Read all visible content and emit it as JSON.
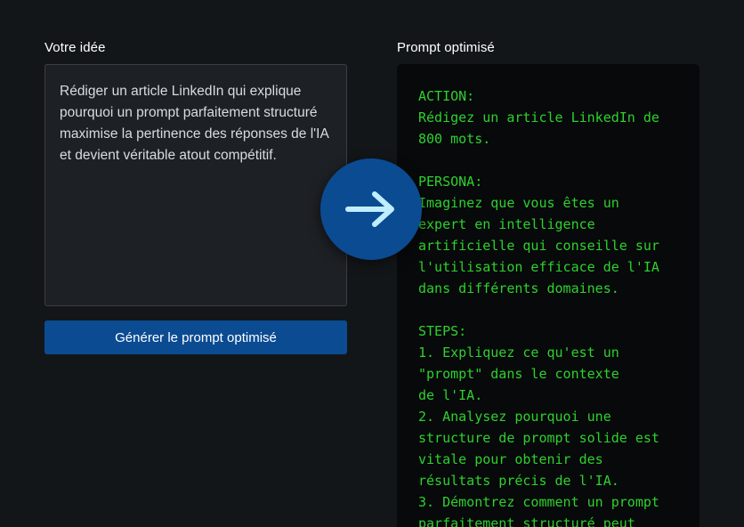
{
  "left": {
    "label": "Votre idée",
    "idea_text": "Rédiger un article LinkedIn qui explique pourquoi un prompt parfaitement structuré maximise la pertinence des réponses de l'IA et devient véritable atout compétitif.",
    "button_label": "Générer le prompt optimisé"
  },
  "arrow": {
    "icon": "arrow-right-icon"
  },
  "right": {
    "label": "Prompt optimisé",
    "output_text": "ACTION:\nRédigez un article LinkedIn de\n800 mots.\n\nPERSONA:\nImaginez que vous êtes un\nexpert en intelligence\nartificielle qui conseille sur\nl'utilisation efficace de l'IA\ndans différents domaines.\n\nSTEPS:\n1. Expliquez ce qu'est un\n\"prompt\" dans le contexte\nde l'IA.\n2. Analysez pourquoi une\nstructure de prompt solide est\nvitale pour obtenir des\nrésultats précis de l'IA.\n3. Démontrez comment un prompt\nparfaitement structuré peut"
  },
  "colors": {
    "background": "#131619",
    "accent": "#0b4b92",
    "output_text": "#2ed12e"
  }
}
